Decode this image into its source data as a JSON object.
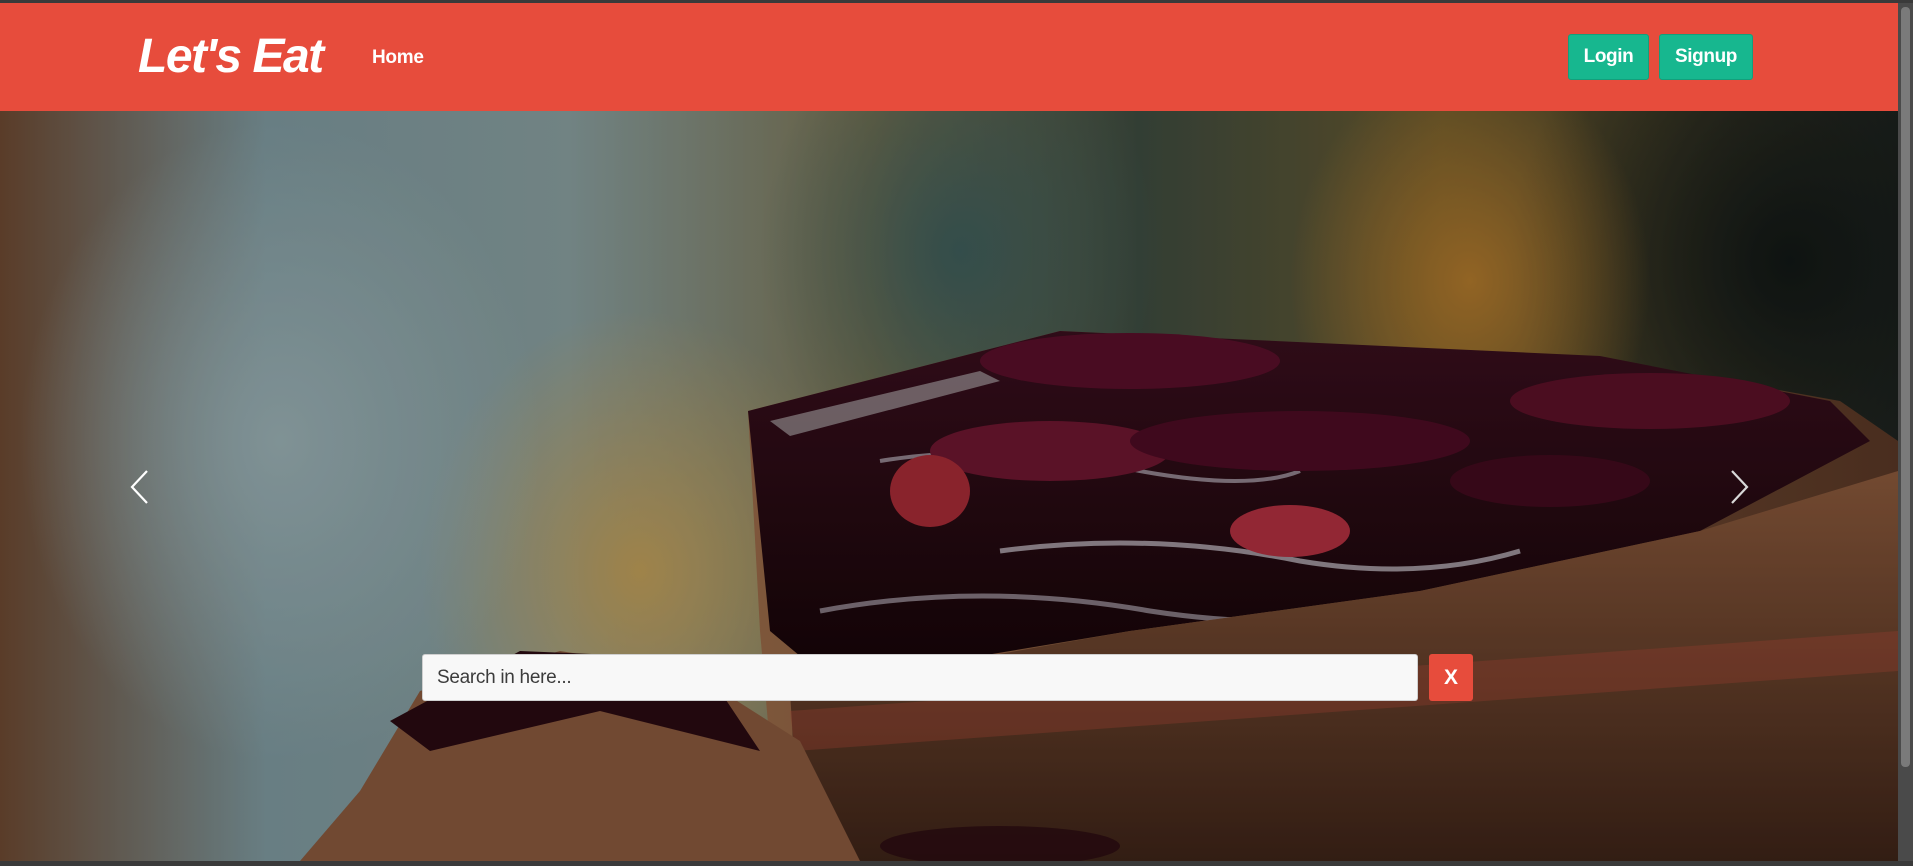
{
  "navbar": {
    "brand": "Let's Eat",
    "home_label": "Home",
    "login_label": "Login",
    "signup_label": "Signup",
    "background_color": "#e74c3c",
    "button_color": "#17b78f"
  },
  "carousel": {
    "prev_icon": "chevron-left-icon",
    "next_icon": "chevron-right-icon",
    "slide_image": "chocolate-cake-photo"
  },
  "search": {
    "placeholder": "Search in here...",
    "value": "",
    "clear_label": "X",
    "clear_color": "#e74c3c"
  }
}
